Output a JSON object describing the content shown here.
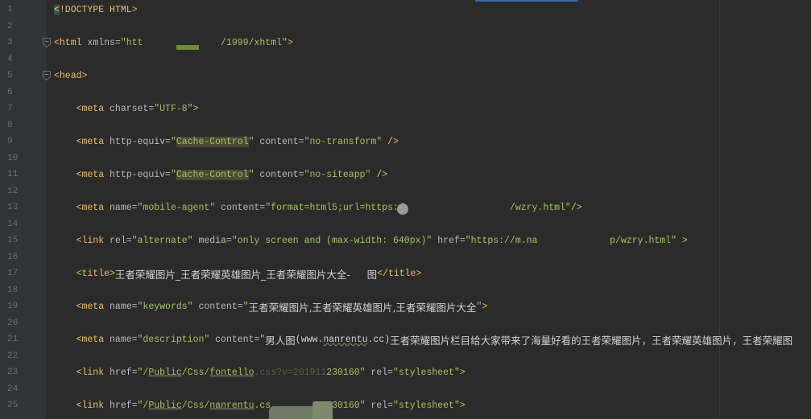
{
  "theme": {
    "background": "#2b2b2b",
    "gutter": "#313335",
    "line_number": "#6d7073",
    "tag": "#e8bf6a",
    "attribute": "#bababa",
    "value": "#a5c261",
    "text": "#d0d0d0"
  },
  "editor": {
    "line_numbers": [
      "1",
      "2",
      "3",
      "4",
      "5",
      "6",
      "7",
      "8",
      "9",
      "10",
      "11",
      "12",
      "13",
      "14",
      "15",
      "16",
      "17",
      "18",
      "19",
      "20",
      "21",
      "22",
      "23",
      "24",
      "25"
    ],
    "lines": {
      "1": [
        "<",
        "!DOCTYPE HTML>"
      ],
      "3": [
        "<html",
        " xmlns=",
        "\"htt",
        "/1999/xhtml\"",
        ">"
      ],
      "5": [
        "<head>"
      ],
      "7": [
        "<meta",
        " charset=",
        "\"UTF-8\"",
        ">"
      ],
      "9": [
        "<meta",
        " http-equiv=",
        "\"",
        "Cache-Control",
        "\"",
        " content=",
        "\"no-transform\"",
        " />"
      ],
      "11": [
        "<meta",
        " http-equiv=",
        "\"",
        "Cache-Control",
        "\"",
        " content=",
        "\"no-siteapp\"",
        " />"
      ],
      "13": [
        "<meta",
        " name=",
        "\"mobile-agent\"",
        " content=",
        "\"format=html5;url=https:/",
        "/wzry.html\"",
        "/>"
      ],
      "15": [
        "<link",
        " rel=",
        "\"alternate\"",
        " media=",
        "\"only screen and (max-width: 640px)\"",
        " href=",
        "\"https://m.na",
        "p/wzry.html\"",
        " >"
      ],
      "17": [
        "<title>",
        "王者荣耀图片_王者荣耀英雄图片_王者荣耀图片大全-",
        "图",
        "</title>"
      ],
      "19": [
        "<meta",
        " name=",
        "\"keywords\"",
        " content=",
        "\"",
        "王者荣耀图片,王者荣耀英雄图片,王者荣耀图片大全",
        "\"",
        ">"
      ],
      "21": [
        "<meta",
        " name=",
        "\"description\"",
        " content=",
        "\"",
        "男人图",
        "(www.",
        "nanrentu",
        ".cc)",
        "王者荣耀图片栏目给大家带来了海量好看的王者荣耀图片，王者荣耀英雄图片，王者荣耀图"
      ],
      "23": [
        "<link",
        " href=",
        "\"/",
        "Public",
        "/Css/",
        "fontello",
        ".css?v=201911",
        "230160\"",
        " rel=",
        "\"stylesheet\"",
        ">"
      ],
      "25": [
        "<link",
        " href=",
        "\"/",
        "Public",
        "/Css/",
        "nanrentu",
        ".cs",
        "230160\"",
        " rel=",
        "\"stylesheet\"",
        ">"
      ]
    }
  }
}
